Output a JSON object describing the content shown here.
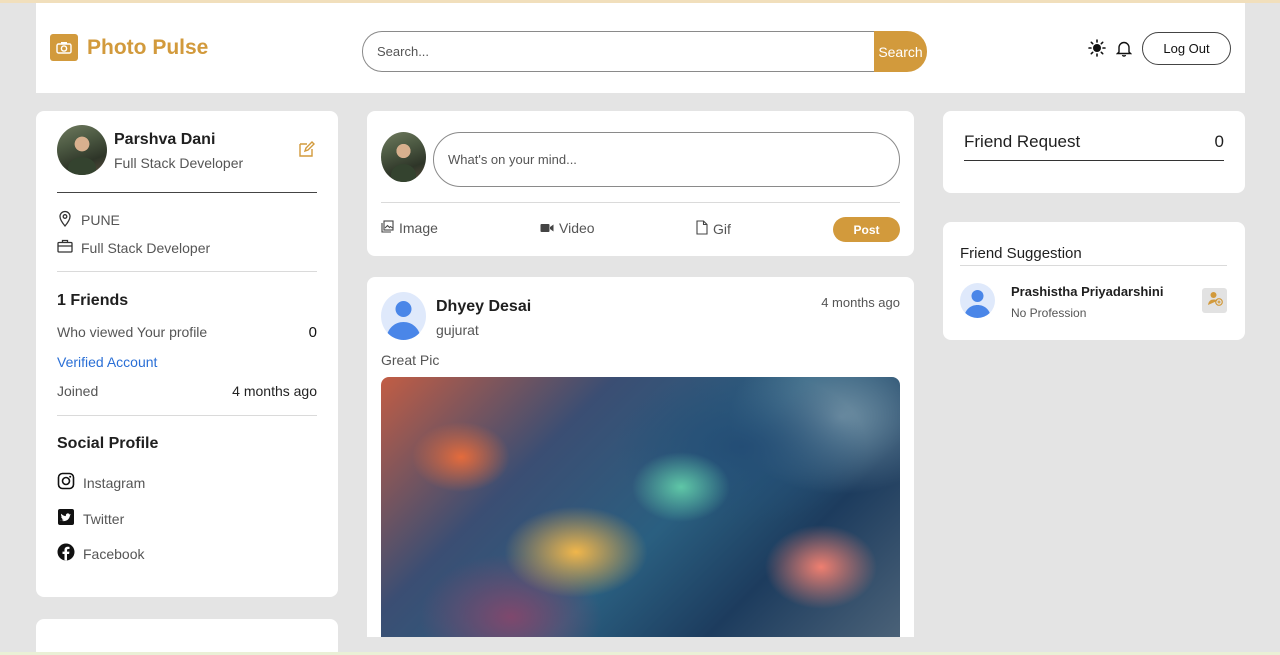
{
  "app": {
    "name": "Photo Pulse"
  },
  "header": {
    "search_placeholder": "Search...",
    "search_button": "Search",
    "logout_label": "Log Out"
  },
  "profile": {
    "name": "Parshva Dani",
    "role": "Full Stack Developer",
    "location": "PUNE",
    "occupation": "Full Stack Developer",
    "friends_label": "1 Friends",
    "viewed_label": "Who viewed Your profile",
    "viewed_count": "0",
    "verified_label": "Verified Account",
    "joined_label": "Joined",
    "joined_value": "4 months ago",
    "social_heading": "Social Profile",
    "social": [
      {
        "label": "Instagram",
        "icon": "instagram-icon"
      },
      {
        "label": "Twitter",
        "icon": "twitter-icon"
      },
      {
        "label": "Facebook",
        "icon": "facebook-icon"
      }
    ]
  },
  "compose": {
    "placeholder": "What's on your mind...",
    "actions": [
      {
        "label": "Image",
        "icon": "image-icon"
      },
      {
        "label": "Video",
        "icon": "video-icon"
      },
      {
        "label": "Gif",
        "icon": "gif-icon"
      }
    ],
    "post_label": "Post"
  },
  "post": {
    "author": "Dhyey Desai",
    "location": "gujurat",
    "time": "4 months ago",
    "caption": "Great Pic"
  },
  "friend_request": {
    "title": "Friend Request",
    "count": "0"
  },
  "friend_suggestion": {
    "title": "Friend Suggestion",
    "items": [
      {
        "name": "Prashistha Priyadarshini",
        "profession": "No Profession"
      }
    ]
  },
  "colors": {
    "accent": "#d29a3c",
    "link": "#2a6fd6",
    "background": "#e4e4e4"
  }
}
